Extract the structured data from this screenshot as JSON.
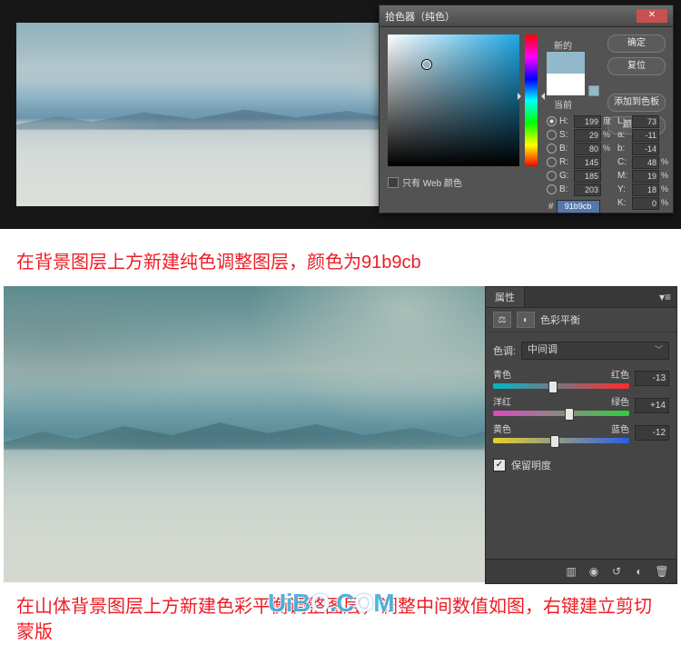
{
  "picker": {
    "title": "拾色器（纯色）",
    "new_label": "新的",
    "current_label": "当前",
    "buttons": {
      "ok": "确定",
      "cancel": "复位",
      "add_swatch": "添加到色板",
      "libraries": "颜色库"
    },
    "hsb": {
      "h": "199",
      "h_unit": "度",
      "s": "29",
      "s_unit": "%",
      "b": "80",
      "b_unit": "%"
    },
    "rgb": {
      "r": "145",
      "g": "185",
      "b": "203"
    },
    "lab": {
      "l": "73",
      "a": "-11",
      "b2": "-14"
    },
    "cmyk": {
      "c": "48",
      "c_unit": "%",
      "m": "19",
      "m_unit": "%",
      "y": "18",
      "y_unit": "%",
      "k": "0",
      "k_unit": "%"
    },
    "web_only": "只有 Web 颜色",
    "hex_prefix": "#",
    "hex": "91b9cb"
  },
  "caption1": "在背景图层上方新建纯色调整图层，颜色为91b9cb",
  "properties": {
    "tab": "属性",
    "title": "色彩平衡",
    "tone_label": "色调:",
    "tone_value": "中间调",
    "sliders": [
      {
        "left": "青色",
        "right": "红色",
        "value": "-13",
        "gradient": "linear-gradient(to right,#00b7c7,#ff2a2a)",
        "pos": 44
      },
      {
        "left": "洋红",
        "right": "绿色",
        "value": "+14",
        "gradient": "linear-gradient(to right,#e046c2,#2fd03b)",
        "pos": 56
      },
      {
        "left": "黄色",
        "right": "蓝色",
        "value": "-12",
        "gradient": "linear-gradient(to right,#e8d22a,#2a5de8)",
        "pos": 45
      }
    ],
    "preserve": "保留明度"
  },
  "caption2": "在山体背景图层上方新建色彩平衡调整图层，调整中间数值如图，右键建立剪切蒙版",
  "watermark": "UiBO.COM"
}
